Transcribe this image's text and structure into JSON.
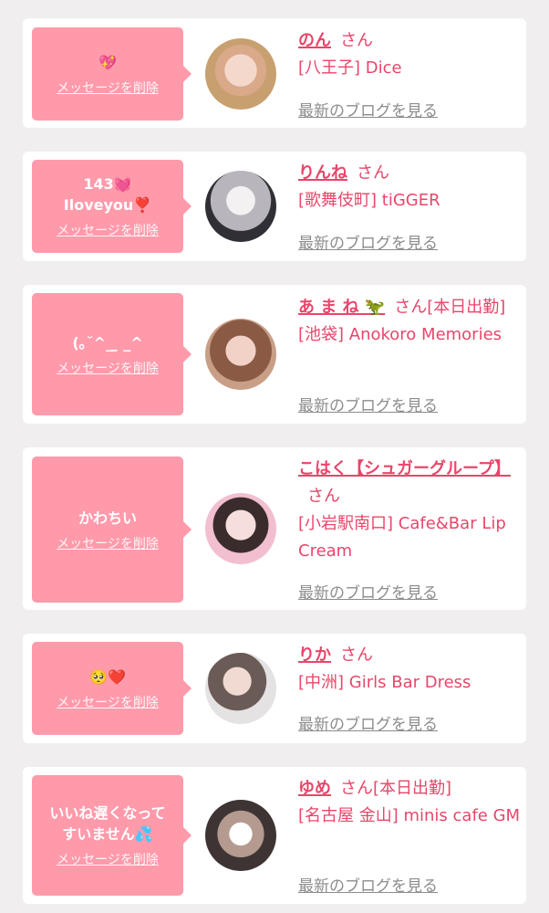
{
  "common": {
    "delete_label": "メッセージを削除",
    "san_label": "さん",
    "blog_label": "最新のブログを見る"
  },
  "entries": [
    {
      "message": "💖",
      "name": "のん",
      "status": "",
      "shop": "[八王子] Dice"
    },
    {
      "message": "143💓\nIloveyou❣️",
      "name": "りんね",
      "status": "",
      "shop": "[歌舞伎町] tiGGER"
    },
    {
      "message": "(｡˘^_ ̫ _^",
      "name": "あ ま ね 🦖",
      "status": "[本日出勤]",
      "shop": "[池袋] Anokoro Memories"
    },
    {
      "message": "かわちい",
      "name": "こはく【シュガーグループ】",
      "status": "",
      "shop": "[小岩駅南口] Cafe&Bar Lip Cream"
    },
    {
      "message": "🥺❤️",
      "name": "りか",
      "status": "",
      "shop": "[中洲] Girls Bar Dress"
    },
    {
      "message": "いいね遅くなって\nすいません💦",
      "name": "ゆめ",
      "status": "[本日出勤]",
      "shop": "[名古屋 金山] minis cafe GM"
    }
  ],
  "colors": {
    "accent": "#e8466a",
    "bubble": "#ff9aab",
    "blog_link": "#8c8c8c",
    "background": "#f1eef0"
  }
}
